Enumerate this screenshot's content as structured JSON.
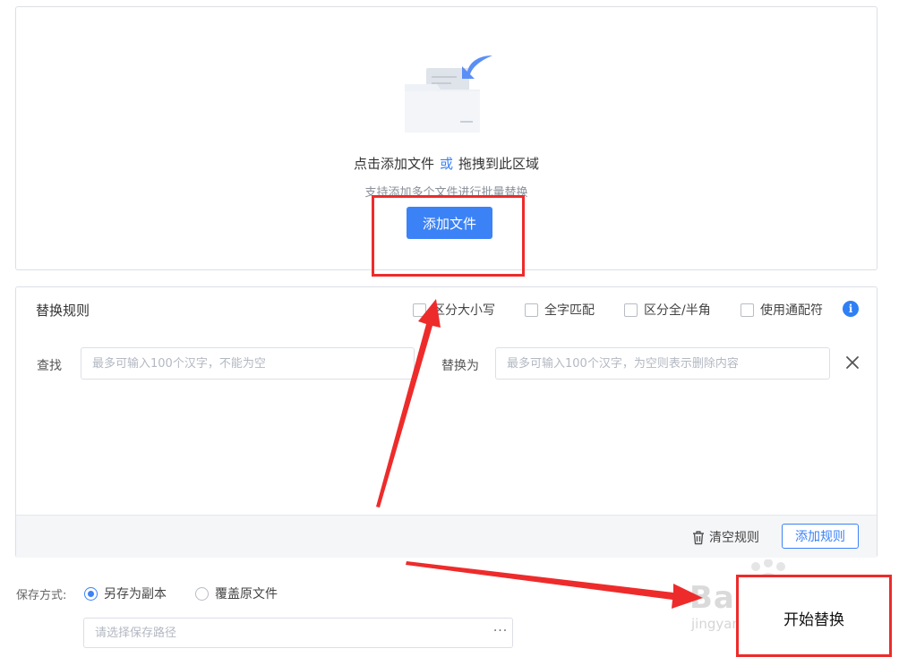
{
  "upload": {
    "title_click": "点击添加文件",
    "title_or": "或",
    "title_drag": "拖拽到此区域",
    "hint": "支持添加多个文件进行批量替换",
    "add_file_label": "添加文件"
  },
  "rules": {
    "title": "替换规则",
    "options": [
      {
        "label": "区分大小写",
        "checked": false
      },
      {
        "label": "全字匹配",
        "checked": false
      },
      {
        "label": "区分全/半角",
        "checked": false
      },
      {
        "label": "使用通配符",
        "checked": false
      }
    ],
    "info_icon": "info-icon",
    "find_label": "查找",
    "find_placeholder": "最多可输入100个汉字，不能为空",
    "replace_label": "替换为",
    "replace_placeholder": "最多可输入100个汉字，为空则表示删除内容",
    "clear_label": "清空规则",
    "add_rule_label": "添加规则"
  },
  "save": {
    "label": "保存方式:",
    "options": [
      {
        "label": "另存为副本",
        "selected": true
      },
      {
        "label": "覆盖原文件",
        "selected": false
      }
    ],
    "path_placeholder": "请选择保存路径",
    "more_label": "···"
  },
  "annotation": {
    "start_label": "开始替换",
    "watermark": "Baidu经验",
    "watermark_sub": "jingyan.baidu.com"
  },
  "colors": {
    "primary": "#3c82f7",
    "annotation_red": "#ee2b2b"
  }
}
